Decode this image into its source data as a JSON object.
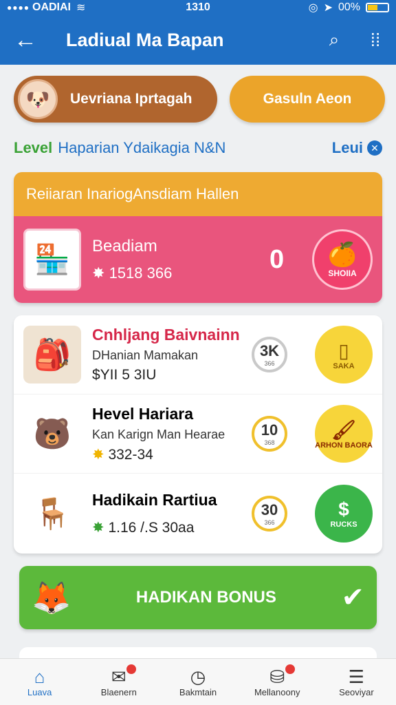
{
  "status": {
    "carrier": "OADIAI",
    "time": "1310",
    "battery": "00%"
  },
  "header": {
    "title": "Ladiual Ma Bapan"
  },
  "pills": {
    "left_label": "Uevriana Iprtagah",
    "right_label": "Gasuln Aeon"
  },
  "level": {
    "prefix": "Level",
    "text": "Haparian Ydaikagia N&N",
    "right": "Leui"
  },
  "section": {
    "title": "Reiiaran InariogAnsdiam Hallen",
    "featured": {
      "name": "Beadiam",
      "price": "1518 366",
      "count": "0",
      "badge": "SHOIIA"
    }
  },
  "items": [
    {
      "title": "Cnhljang Baivnainn",
      "subtitle": "DHanian Mamakan",
      "price": "$YII 5 3IU",
      "ring": "3K",
      "ring_sub": "366",
      "button": "SAKA",
      "color": "#d6284a"
    },
    {
      "title": "Hevel Hariara",
      "subtitle": "Kan Karign Man Hearae",
      "price": "332-34",
      "ring": "10",
      "ring_sub": "368",
      "button": "ARHON BAORA",
      "color": "#1a1a1a"
    },
    {
      "title": "Hadikain Rartiua",
      "subtitle": "",
      "price": "1.16 /.S 30aa",
      "ring": "30",
      "ring_sub": "366",
      "button": "RUCKS",
      "color": "#1a1a1a"
    }
  ],
  "bonus": {
    "label": "HADIKAN BONUS"
  },
  "nav": [
    {
      "label": "Luava",
      "icon": "home-icon"
    },
    {
      "label": "Blaenern",
      "icon": "mail-icon"
    },
    {
      "label": "Bakmtain",
      "icon": "clock-icon"
    },
    {
      "label": "Mellanoony",
      "icon": "bag-icon"
    },
    {
      "label": "Seoviyar",
      "icon": "menu-icon"
    }
  ]
}
